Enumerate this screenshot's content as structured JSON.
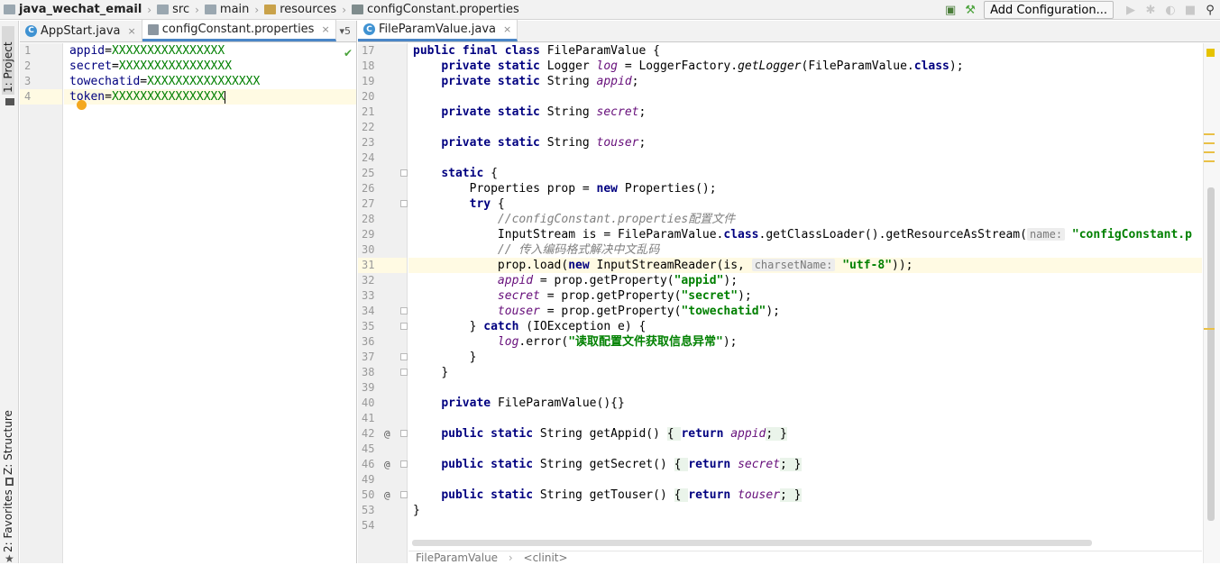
{
  "navbar": {
    "project": "java_wechat_email",
    "crumbs": [
      "src",
      "main",
      "resources",
      "configConstant.properties"
    ],
    "run_config_label": "Add Configuration..."
  },
  "left_stripe": {
    "tabs": [
      "1: Project",
      "Z: Structure",
      "2: Favorites"
    ]
  },
  "left_editor": {
    "tabs": [
      {
        "label": "AppStart.java",
        "close": "×"
      },
      {
        "label": "configConstant.properties",
        "close": "×"
      }
    ],
    "tab_menu": "▾5",
    "line_numbers": [
      "1",
      "2",
      "3",
      "4"
    ],
    "lines": [
      {
        "key": "appid",
        "eq": "=",
        "value": "XXXXXXXXXXXXXXXX"
      },
      {
        "key": "secret",
        "eq": "=",
        "value": "XXXXXXXXXXXXXXXX"
      },
      {
        "key": "towechatid",
        "eq": "=",
        "value": "XXXXXXXXXXXXXXXX"
      },
      {
        "key": "token",
        "eq": "=",
        "value": "XXXXXXXXXXXXXXXX"
      }
    ]
  },
  "right_editor": {
    "tab": {
      "label": "FileParamValue.java",
      "close": "×"
    },
    "line_numbers": [
      "17",
      "18",
      "19",
      "20",
      "21",
      "22",
      "23",
      "24",
      "25",
      "26",
      "27",
      "28",
      "29",
      "30",
      "31",
      "32",
      "33",
      "34",
      "35",
      "36",
      "37",
      "38",
      "39",
      "40",
      "41",
      "42",
      "45",
      "46",
      "49",
      "50",
      "53",
      "54"
    ],
    "override_markers": {
      "42": "@",
      "46": "@",
      "50": "@"
    },
    "code": {
      "l17": [
        "public final class ",
        "FileParamValue {"
      ],
      "l18": [
        "private static ",
        "Logger ",
        "log",
        " = LoggerFactory.",
        "getLogger",
        "(FileParamValue.",
        "class",
        ");"
      ],
      "l19": [
        "private static ",
        "String ",
        "appid",
        ";"
      ],
      "l21": [
        "private static ",
        "String ",
        "secret",
        ";"
      ],
      "l23": [
        "private static ",
        "String ",
        "touser",
        ";"
      ],
      "l25": [
        "static",
        " {"
      ],
      "l26": [
        "Properties prop = ",
        "new",
        " Properties();"
      ],
      "l27": [
        "try",
        " {"
      ],
      "l28": "//configConstant.properties配置文件",
      "l29": [
        "InputStream is = FileParamValue.",
        "class",
        ".getClassLoader().getResourceAsStream(",
        "name:",
        "\"configConstant.p"
      ],
      "l30": "// 传入编码格式解决中文乱码",
      "l31": [
        "prop.load(",
        "new",
        " InputStreamReader(is, ",
        "charsetName:",
        "\"utf-8\"",
        "));"
      ],
      "l32": [
        "appid",
        " = prop.getProperty(",
        "\"appid\"",
        ");"
      ],
      "l33": [
        "secret",
        " = prop.getProperty(",
        "\"secret\"",
        ");"
      ],
      "l34": [
        "touser",
        " = prop.getProperty(",
        "\"towechatid\"",
        ");"
      ],
      "l35": [
        "} ",
        "catch",
        " (IOException e) {"
      ],
      "l36": [
        "log",
        ".error(",
        "\"读取配置文件获取信息异常\"",
        ");"
      ],
      "l37": "}",
      "l38": "}",
      "l40": [
        "private ",
        "FileParamValue(){}"
      ],
      "l42": [
        "public static ",
        "String getAppid() ",
        "{ ",
        "return ",
        "appid",
        "; }"
      ],
      "l46": [
        "public static ",
        "String getSecret() ",
        "{ ",
        "return ",
        "secret",
        "; }"
      ],
      "l50": [
        "public static ",
        "String getTouser() ",
        "{ ",
        "return ",
        "touser",
        "; }"
      ],
      "l53": "}"
    },
    "bottom_breadcrumb": [
      "FileParamValue",
      "<clinit>"
    ]
  },
  "colors": {
    "keyword": "#000080",
    "field": "#660e7a",
    "string": "#008000",
    "comment": "#808080",
    "current_line": "#fffae3",
    "tab_active_underline": "#4a86c7"
  }
}
